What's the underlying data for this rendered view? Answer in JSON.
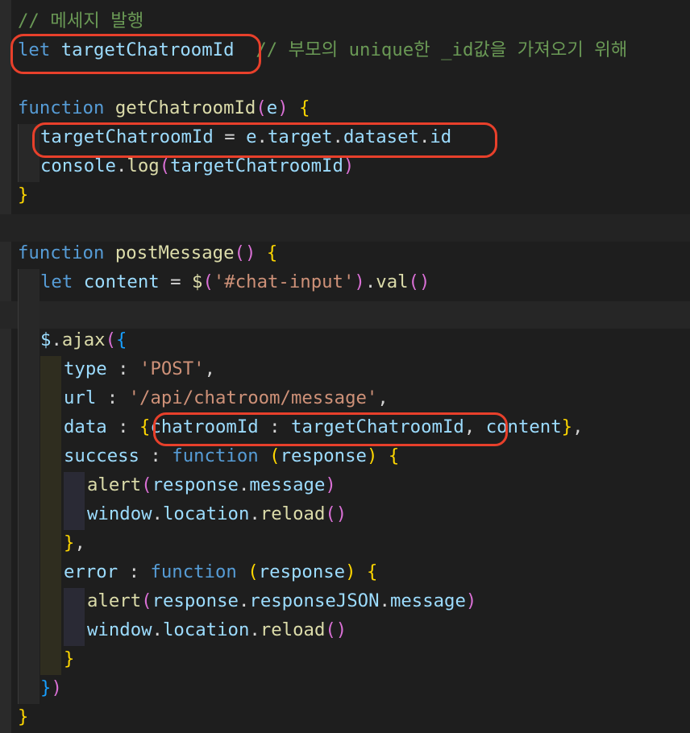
{
  "editor": {
    "theme_colors": {
      "background": "#1e1e1e",
      "comment": "#6a9955",
      "keyword": "#569cd6",
      "function": "#dcdcaa",
      "variable": "#9cdcfe",
      "string": "#ce9178",
      "bracket_gold": "#ffd700",
      "bracket_purple": "#da70d6",
      "bracket_blue": "#179fff",
      "annotation_circle": "#e8402b"
    },
    "lines": {
      "l1": {
        "comment": "// 메세지 발행"
      },
      "l2": {
        "kw": "let",
        "name": "targetChatroomId",
        "comment": "// 부모의 unique한 _id값을 가져오기 위해"
      },
      "l4": {
        "kw": "function",
        "name": "getChatroomId",
        "open": "(",
        "param": "e",
        "close": ")",
        "brace": "{"
      },
      "l5": {
        "lhs": "targetChatroomId",
        "eq": "=",
        "obj": "e",
        "d1": ".",
        "p1": "target",
        "d2": ".",
        "p2": "dataset",
        "d3": ".",
        "p3": "id"
      },
      "l6": {
        "obj": "console",
        "dot": ".",
        "method": "log",
        "open": "(",
        "arg": "targetChatroomId",
        "close": ")"
      },
      "l7": {
        "brace": "}"
      },
      "l9": {
        "kw": "function",
        "name": "postMessage",
        "parens": "()",
        "brace": "{"
      },
      "l10": {
        "kw": "let",
        "name": "content",
        "eq": "=",
        "fn": "$",
        "open": "(",
        "str": "'#chat-input'",
        "close": ")",
        "dot": ".",
        "method": "val",
        "parens": "()"
      },
      "l12": {
        "obj": "$",
        "dot": ".",
        "method": "ajax",
        "open": "(",
        "brace": "{"
      },
      "l13": {
        "key": "type",
        "colon": ":",
        "str": "'POST'",
        "comma": ","
      },
      "l14": {
        "key": "url",
        "colon": ":",
        "str": "'/api/chatroom/message'",
        "comma": ","
      },
      "l15": {
        "key": "data",
        "colon": ":",
        "open": "{",
        "k1": "chatroomId",
        "c1": ":",
        "v1": "targetChatroomId",
        "comma1": ",",
        "v2": "content",
        "close": "}",
        "comma": ","
      },
      "l16": {
        "key": "success",
        "colon": ":",
        "kw": "function",
        "open": "(",
        "param": "response",
        "close": ")",
        "brace": "{"
      },
      "l17": {
        "fn": "alert",
        "open": "(",
        "obj": "response",
        "dot": ".",
        "prop": "message",
        "close": ")"
      },
      "l18": {
        "obj": "window",
        "d1": ".",
        "prop": "location",
        "d2": ".",
        "method": "reload",
        "parens": "()"
      },
      "l19": {
        "brace": "}",
        "comma": ","
      },
      "l20": {
        "key": "error",
        "colon": ":",
        "kw": "function",
        "open": "(",
        "param": "response",
        "close": ")",
        "brace": "{"
      },
      "l21": {
        "fn": "alert",
        "open": "(",
        "obj": "response",
        "d1": ".",
        "prop1": "responseJSON",
        "d2": ".",
        "prop2": "message",
        "close": ")"
      },
      "l22": {
        "obj": "window",
        "d1": ".",
        "prop": "location",
        "d2": ".",
        "method": "reload",
        "parens": "()"
      },
      "l23": {
        "brace": "}"
      },
      "l24": {
        "brace": "}",
        "paren": ")"
      },
      "l25": {
        "brace": "}"
      }
    }
  }
}
